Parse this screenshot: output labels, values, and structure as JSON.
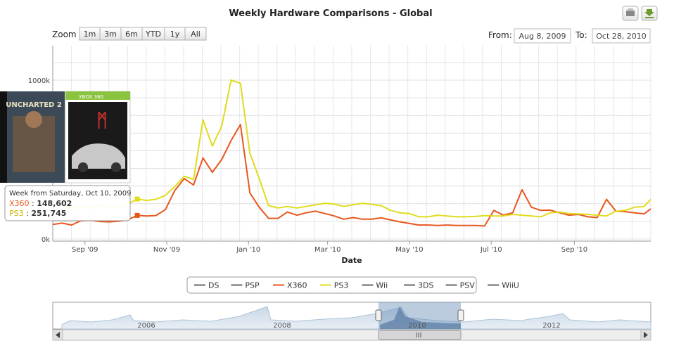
{
  "chart_data": {
    "type": "line",
    "title": "Weekly Hardware Comparisons - Global",
    "xlabel": "Date",
    "ylabel": "",
    "ylim": [
      0,
      1000000
    ],
    "y_ticks": [
      "0k",
      "1000k"
    ],
    "x_ticks": [
      "Sep '09",
      "Nov '09",
      "Jan '10",
      "Mar '10",
      "May '10",
      "Jul '10",
      "Sep '10"
    ],
    "x_range": [
      "2009-08-08",
      "2010-10-28"
    ],
    "grid": true,
    "legend_position": "bottom",
    "legend": [
      "DS",
      "PSP",
      "X360",
      "PS3",
      "Wii",
      "3DS",
      "PSV",
      "WiiU"
    ],
    "legend_colors": [
      "#666666",
      "#666666",
      "#e8561e",
      "#e0dc1e",
      "#666666",
      "#666666",
      "#666666",
      "#666666"
    ],
    "x": [
      "2009-08-08",
      "2009-08-15",
      "2009-08-22",
      "2009-08-29",
      "2009-09-05",
      "2009-09-12",
      "2009-09-19",
      "2009-09-26",
      "2009-10-03",
      "2009-10-10",
      "2009-10-17",
      "2009-10-24",
      "2009-10-31",
      "2009-11-07",
      "2009-11-14",
      "2009-11-21",
      "2009-11-28",
      "2009-12-05",
      "2009-12-12",
      "2009-12-19",
      "2009-12-26",
      "2010-01-02",
      "2010-01-09",
      "2010-01-16",
      "2010-01-23",
      "2010-01-30",
      "2010-02-06",
      "2010-02-13",
      "2010-02-20",
      "2010-02-27",
      "2010-03-06",
      "2010-03-13",
      "2010-03-20",
      "2010-03-27",
      "2010-04-03",
      "2010-04-10",
      "2010-04-17",
      "2010-04-24",
      "2010-05-01",
      "2010-05-08",
      "2010-05-15",
      "2010-05-22",
      "2010-05-29",
      "2010-06-05",
      "2010-06-12",
      "2010-06-19",
      "2010-06-26",
      "2010-07-03",
      "2010-07-10",
      "2010-07-17",
      "2010-07-24",
      "2010-07-31",
      "2010-08-07",
      "2010-08-14",
      "2010-08-21",
      "2010-08-28",
      "2010-09-04",
      "2010-09-11",
      "2010-09-18",
      "2010-09-25",
      "2010-10-02",
      "2010-10-09",
      "2010-10-16",
      "2010-10-23",
      "2010-10-28"
    ],
    "series": [
      {
        "name": "X360",
        "color": "#e8561e",
        "values": [
          92000,
          100000,
          88000,
          115000,
          118000,
          110000,
          108000,
          112000,
          121000,
          148602,
          145000,
          148000,
          185000,
          305000,
          380000,
          340000,
          510000,
          420000,
          500000,
          620000,
          720000,
          290000,
          200000,
          130000,
          130000,
          170000,
          150000,
          165000,
          175000,
          160000,
          145000,
          125000,
          135000,
          125000,
          125000,
          133000,
          120000,
          108000,
          98000,
          88000,
          88000,
          85000,
          88000,
          85000,
          85000,
          85000,
          82000,
          180000,
          150000,
          165000,
          310000,
          200000,
          180000,
          182000,
          165000,
          150000,
          155000,
          140000,
          135000,
          250000,
          175000,
          172000,
          165000,
          158000,
          190000
        ]
      },
      {
        "name": "PS3",
        "color": "#e0dc1e",
        "values": [
          220000,
          215000,
          190000,
          205000,
          195000,
          210000,
          205000,
          200000,
          220000,
          251745,
          243000,
          250000,
          275000,
          330000,
          395000,
          375000,
          750000,
          585000,
          710000,
          1000000,
          980000,
          540000,
          380000,
          210000,
          195000,
          205000,
          195000,
          205000,
          215000,
          225000,
          220000,
          205000,
          215000,
          225000,
          218000,
          210000,
          180000,
          165000,
          160000,
          140000,
          140000,
          150000,
          145000,
          140000,
          140000,
          142000,
          147000,
          145000,
          145000,
          155000,
          150000,
          145000,
          140000,
          165000,
          170000,
          160000,
          158000,
          155000,
          150000,
          145000,
          175000,
          180000,
          200000,
          205000,
          250000
        ]
      },
      {
        "name": "DS",
        "values": []
      },
      {
        "name": "PSP",
        "values": []
      },
      {
        "name": "Wii",
        "values": []
      },
      {
        "name": "3DS",
        "values": []
      },
      {
        "name": "PSV",
        "values": []
      },
      {
        "name": "WiiU",
        "values": []
      }
    ],
    "tooltip": {
      "header": "Week from Saturday, Oct 10, 2009",
      "rows": [
        {
          "name": "X360",
          "value": "148,602",
          "color": "#e8561e"
        },
        {
          "name": "PS3",
          "value": "251,745",
          "color": "#e0dc1e"
        }
      ]
    },
    "navigator": {
      "year_labels": [
        "2006",
        "2008",
        "2010",
        "2012"
      ],
      "selection": [
        "2009-08-08",
        "2010-10-28"
      ]
    }
  },
  "zoom": {
    "label": "Zoom",
    "buttons": [
      "1m",
      "3m",
      "6m",
      "YTD",
      "1y",
      "All"
    ]
  },
  "range": {
    "from_label": "From:",
    "from_value": "Aug 8, 2009",
    "to_label": "To:",
    "to_value": "Oct 28, 2010"
  },
  "images": [
    {
      "name": "Uncharted 2 cover",
      "text": "UNCHARTED 2"
    },
    {
      "name": "Forza Motorsport 3 cover",
      "text": "XBOX 360"
    }
  ]
}
